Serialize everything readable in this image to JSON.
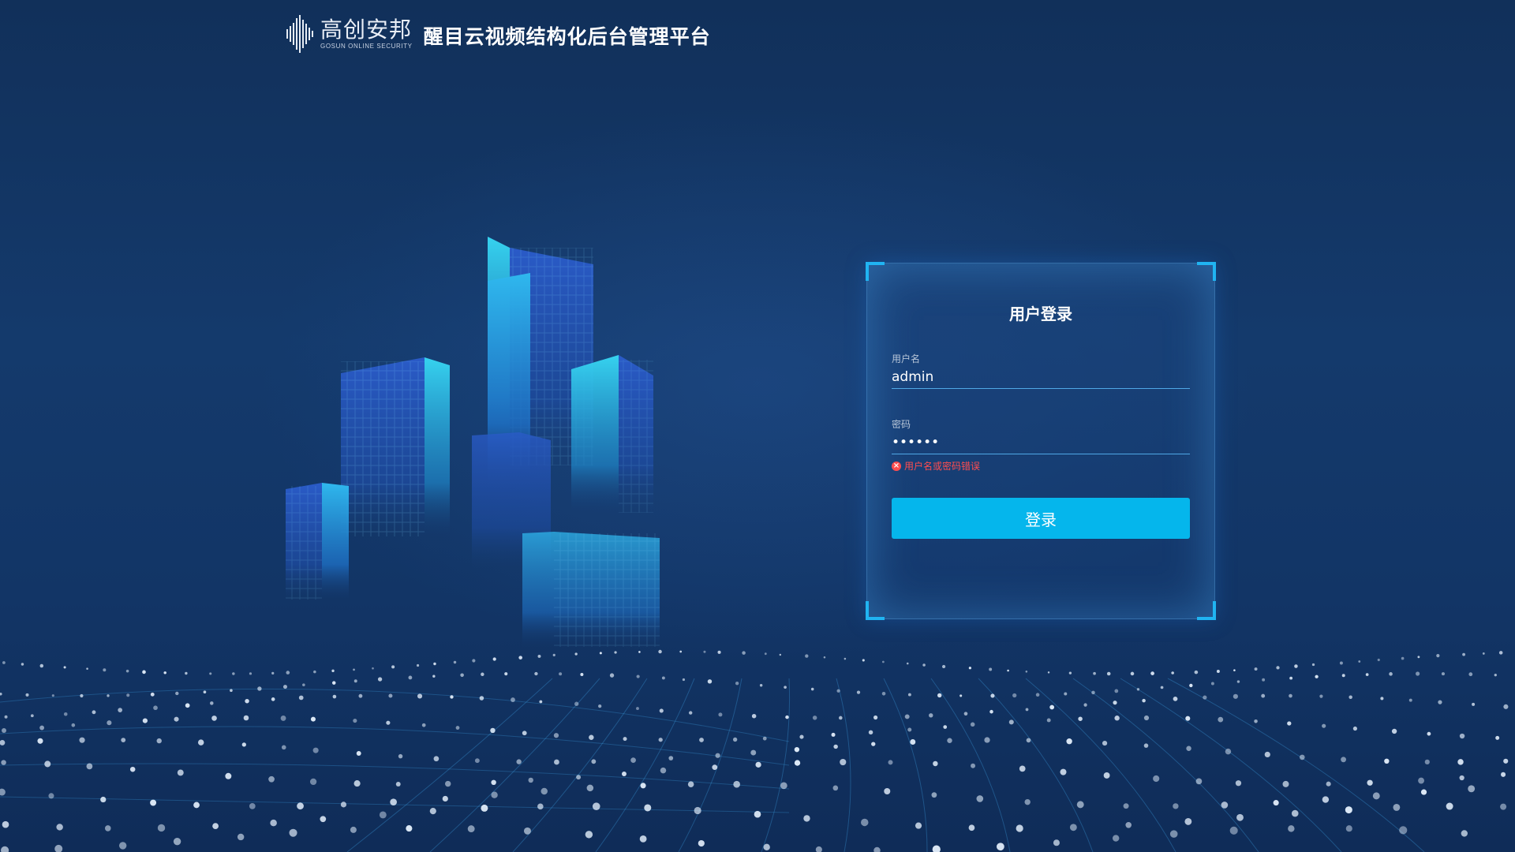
{
  "header": {
    "logo_cn": "高创安邦",
    "logo_en": "GOSUN ONLINE SECURITY",
    "app_title": "醒目云视频结构化后台管理平台"
  },
  "login": {
    "title": "用户登录",
    "username_label": "用户名",
    "username_value": "admin",
    "password_label": "密码",
    "password_value": "123456",
    "error_message": "用户名或密码错误",
    "submit_label": "登录"
  },
  "colors": {
    "accent": "#05b6ec",
    "error": "#ff4d4f",
    "background": "#143a6c"
  },
  "icons": {
    "brand": "waveform-logo-icon",
    "error": "error-circle-icon"
  }
}
